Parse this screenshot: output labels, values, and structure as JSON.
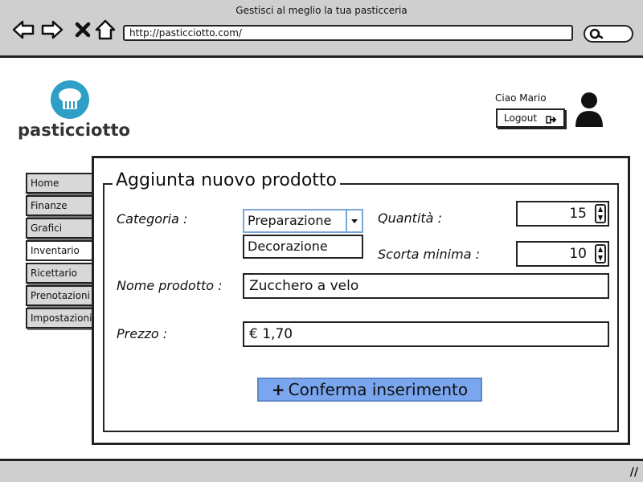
{
  "window": {
    "title": "Gestisci al meglio la tua pasticceria",
    "url": "http://pasticciotto.com/"
  },
  "icons": {
    "back": "arrow-left-icon",
    "forward": "arrow-right-icon",
    "stop": "close-icon",
    "home": "home-icon",
    "search": "search-icon",
    "logo": "chef-logo-icon",
    "logout": "logout-icon",
    "user": "user-icon",
    "resize": "resize-grip-icon"
  },
  "brand": {
    "name": "pasticciotto",
    "color": "#2e9fc6"
  },
  "user": {
    "greeting": "Ciao Mario",
    "logout_label": "Logout"
  },
  "sidebar": {
    "items": [
      {
        "label": "Home"
      },
      {
        "label": "Finanze"
      },
      {
        "label": "Grafici"
      },
      {
        "label": "Inventario",
        "active": true
      },
      {
        "label": "Ricettario"
      },
      {
        "label": "Prenotazioni"
      },
      {
        "label": "Impostazioni"
      }
    ]
  },
  "form": {
    "title": "Aggiunta nuovo prodotto",
    "category_label": "Categoria :",
    "category_value": "Preparazione",
    "category_dropdown_option": "Decorazione",
    "quantity_label": "Quantità :",
    "quantity_value": "15",
    "min_stock_label": "Scorta minima :",
    "min_stock_value": "10",
    "name_label": "Nome prodotto :",
    "name_value": "Zucchero a velo",
    "price_label": "Prezzo :",
    "price_value": "€ 1,70",
    "confirm_icon": "+",
    "confirm_label": "Conferma inserimento",
    "accent_color": "#7aa6ef"
  },
  "statusbar": {
    "grip": "//"
  }
}
